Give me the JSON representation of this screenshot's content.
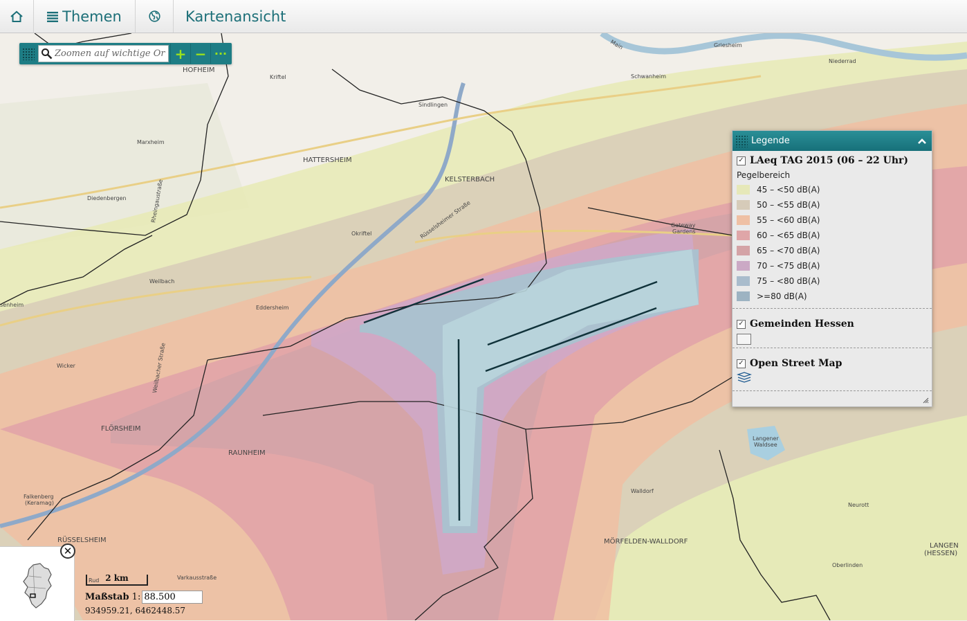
{
  "topbar": {
    "home_icon": "home-icon",
    "themes_icon": "list-icon",
    "themes_label": "Themen",
    "globe_icon": "globe-icon",
    "view_label": "Kartenansicht",
    "accent": "#1c6f78"
  },
  "search": {
    "placeholder": "Zoomen auf wichtige Ort",
    "zoom_in": "+",
    "zoom_out": "−",
    "more": "···"
  },
  "legend": {
    "title": "Legende",
    "layers": [
      {
        "name": "LAeq TAG 2015 (06 – 22 Uhr)",
        "checked": true,
        "sublabel": "Pegelbereich",
        "classes": [
          {
            "label": "45 – <50 dB(A)",
            "color": "#e6e8b8"
          },
          {
            "label": "50 – <55 dB(A)",
            "color": "#d6cbb9"
          },
          {
            "label": "55 – <60 dB(A)",
            "color": "#efc0a4"
          },
          {
            "label": "60 – <65 dB(A)",
            "color": "#dfa6a8"
          },
          {
            "label": "65 – <70 dB(A)",
            "color": "#d4a3a6"
          },
          {
            "label": "70 – <75 dB(A)",
            "color": "#cba9c5"
          },
          {
            "label": "75 – <80 dB(A)",
            "color": "#a9bccc"
          },
          {
            "label": ">=80 dB(A)",
            "color": "#9db3c2"
          }
        ]
      },
      {
        "name": "Gemeinden Hessen",
        "checked": true
      },
      {
        "name": "Open Street Map",
        "checked": true
      }
    ]
  },
  "places": {
    "hofheim": "HOFHEIM",
    "kriftel": "Kriftel",
    "hattersheim": "HATTERSHEIM",
    "kelsterbach": "KELSTERBACH",
    "sindlingen": "Sindlingen",
    "schwanheim": "Schwanheim",
    "griesheim": "Griesheim",
    "niederrad": "Niederrad",
    "marxheim": "Marxheim",
    "diedenbergen": "Diedenbergen",
    "okriftel": "Okriftel",
    "weilbach": "Weilbach",
    "eddersheim": "Eddersheim",
    "wicker": "Wicker",
    "floersheim": "FLÖRSHEIM",
    "raunheim": "RAUNHEIM",
    "ruesselsheim": "RÜSSELSHEIM",
    "walldorf": "Walldorf",
    "moerfelden": "MÖRFELDEN-WALLDORF",
    "neurott": "Neurott",
    "langen_1": "LANGEN",
    "langen_2": "(HESSEN)",
    "oberlinden": "Oberlinden",
    "gateway_1": "Gateway",
    "gateway_2": "Gardens",
    "langener_1": "Langener",
    "langener_2": "Waldsee",
    "falkenberg_1": "Falkenberg",
    "falkenberg_2": "(Keramag)",
    "senheim": "senheim",
    "varkausstrasse": "Varkausstraße",
    "rheingaustrasse": "Rheingaustraße",
    "weilbacher": "Weilbacher Straße",
    "ruesselsheimer": "Rüsselsheimer Straße",
    "main": "Main",
    "rud": "Rud"
  },
  "scale": {
    "bar_label": "2 km",
    "label": "Maßstab",
    "prefix": "1:",
    "value": "88.500",
    "coords": "934959.21, 6462448.57",
    "close": "✕"
  }
}
